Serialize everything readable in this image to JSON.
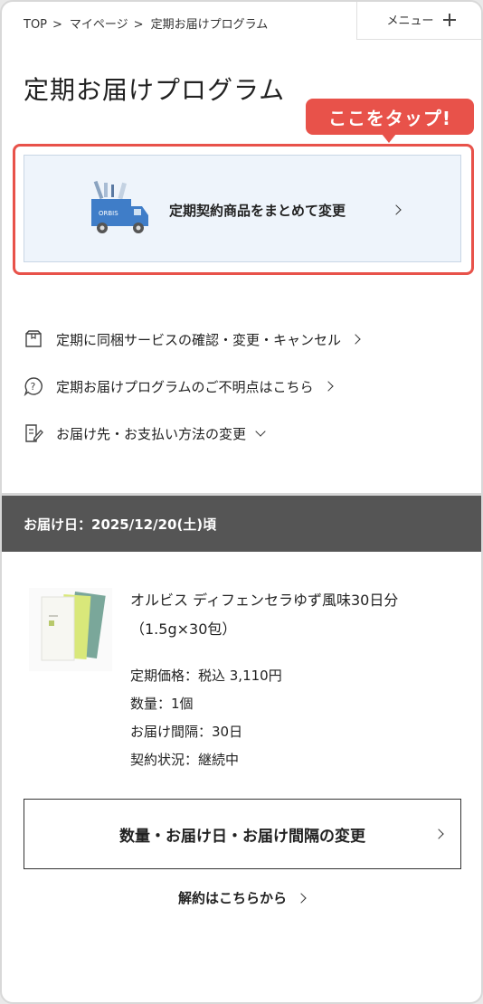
{
  "breadcrumb": [
    {
      "label": "TOP"
    },
    {
      "label": "マイページ"
    },
    {
      "label": "定期お届けプログラム"
    }
  ],
  "menu": {
    "label": "メニュー"
  },
  "page": {
    "title": "定期お届けプログラム"
  },
  "callout": {
    "label": "ここをタップ!",
    "color": "#e8524a"
  },
  "bulk_change": {
    "label": "定期契約商品をまとめて変更",
    "truck_logo": "ORBIS",
    "icon": "delivery-truck-icon"
  },
  "links": [
    {
      "label": "定期に同梱サービスの確認・変更・キャンセル",
      "icon": "package-box-icon"
    },
    {
      "label": "定期お届けプログラムのご不明点はこちら",
      "icon": "question-bubble-icon"
    },
    {
      "label": "お届け先・お支払い方法の変更",
      "icon": "edit-document-icon"
    }
  ],
  "delivery": {
    "label": "お届け日：2025/12/20(土)頃"
  },
  "product": {
    "name": "オルビス ディフェンセラゆず風味30日分（1.5g×30包）",
    "specs": [
      "定期価格：税込 3,110円",
      "数量：1個",
      "お届け間隔：30日",
      "契約状況：継続中"
    ]
  },
  "actions": {
    "change_label": "数量・お届け日・お届け間隔の変更",
    "cancel_label": "解約はこちらから"
  }
}
